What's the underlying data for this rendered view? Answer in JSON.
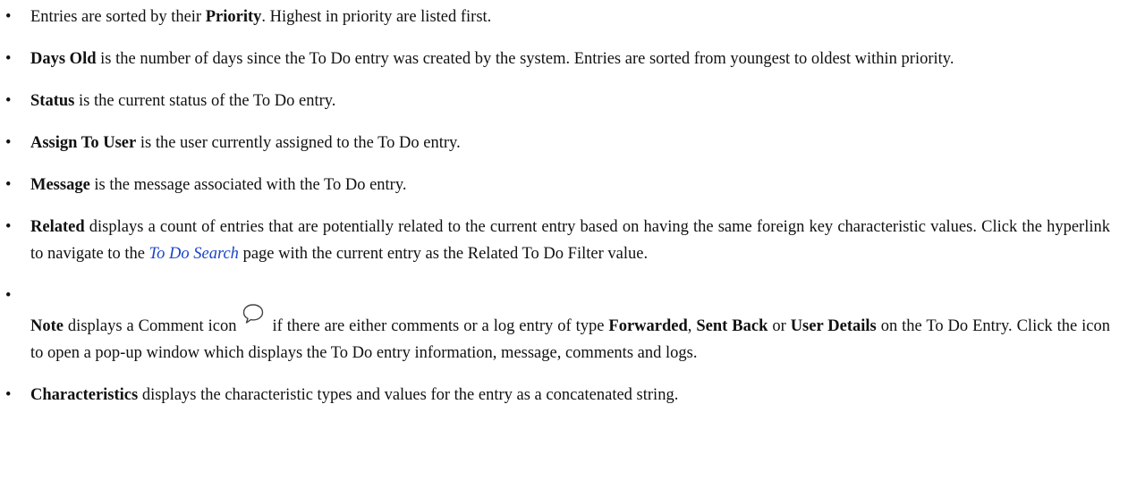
{
  "items": [
    {
      "segments": [
        {
          "t": "Entries are sorted by their "
        },
        {
          "t": "Priority",
          "b": true
        },
        {
          "t": ". Highest in priority are listed first."
        }
      ]
    },
    {
      "segments": [
        {
          "t": "Days Old",
          "b": true
        },
        {
          "t": " is the number of days since the To Do entry was created by the system. Entries are sorted from youngest to oldest within priority."
        }
      ]
    },
    {
      "segments": [
        {
          "t": "Status",
          "b": true
        },
        {
          "t": " is the current status of the To Do entry."
        }
      ]
    },
    {
      "segments": [
        {
          "t": "Assign To User",
          "b": true
        },
        {
          "t": " is the user currently assigned to the To Do entry."
        }
      ]
    },
    {
      "segments": [
        {
          "t": "Message",
          "b": true
        },
        {
          "t": " is the message associated with the To Do entry."
        }
      ]
    },
    {
      "segments": [
        {
          "t": "Related",
          "b": true
        },
        {
          "t": " displays a count of entries that are potentially related to the current entry based on having the same foreign key characteristic values. Click the hyperlink to navigate to the "
        },
        {
          "t": "To Do Search",
          "link": true
        },
        {
          "t": " page with the current entry as the Related To Do Filter value."
        }
      ]
    },
    {
      "gapBefore": true,
      "segments": [
        {
          "t": "Note",
          "b": true
        },
        {
          "t": " displays a Comment icon"
        },
        {
          "icon": "comment-icon"
        },
        {
          "t": "if there are either comments or a log entry of type "
        },
        {
          "t": "Forwarded",
          "b": true
        },
        {
          "t": ", "
        },
        {
          "t": "Sent Back",
          "b": true
        },
        {
          "t": " or "
        },
        {
          "t": "User Details",
          "b": true
        },
        {
          "t": " on the To Do Entry. Click the icon to open a pop-up window which displays the To Do entry information, message, comments and logs."
        }
      ]
    },
    {
      "segments": [
        {
          "t": "Characteristics",
          "b": true
        },
        {
          "t": " displays the characteristic types and values for the entry as a concatenated string."
        }
      ]
    }
  ],
  "bullet_char": "•"
}
